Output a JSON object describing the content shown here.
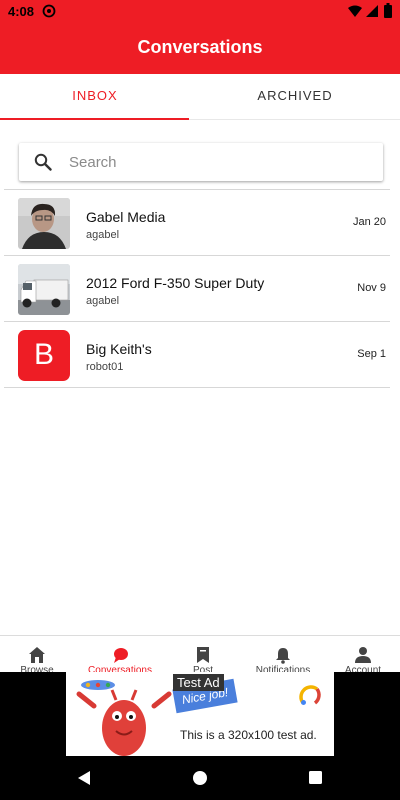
{
  "status_bar": {
    "time": "4:08"
  },
  "app_bar": {
    "title": "Conversations"
  },
  "tabs": [
    {
      "label": "INBOX",
      "active": true
    },
    {
      "label": "ARCHIVED",
      "active": false
    }
  ],
  "search": {
    "placeholder": "Search"
  },
  "conversations": [
    {
      "name": "Gabel Media",
      "user": "agabel",
      "date": "Jan 20",
      "thumbnail": "person-photo"
    },
    {
      "name": "2012 Ford F-350 Super Duty",
      "user": "agabel",
      "date": "Nov 9",
      "thumbnail": "truck-photo"
    },
    {
      "name": "Big Keith's",
      "user": "robot01",
      "date": "Sep 1",
      "thumbnail": "letter-b",
      "thumb_letter": "B"
    }
  ],
  "bottom_nav": [
    {
      "label": "Browse",
      "icon": "home-icon"
    },
    {
      "label": "Conversations",
      "icon": "chat-bubble-icon",
      "active": true
    },
    {
      "label": "Post",
      "icon": "bookmark-icon"
    },
    {
      "label": "Notifications",
      "icon": "bell-icon"
    },
    {
      "label": "Account",
      "icon": "person-icon"
    }
  ],
  "ad": {
    "label": "Test Ad",
    "banner_text": "Nice job!",
    "text": "This is a 320x100 test ad."
  },
  "colors": {
    "accent": "#ee1d25"
  }
}
